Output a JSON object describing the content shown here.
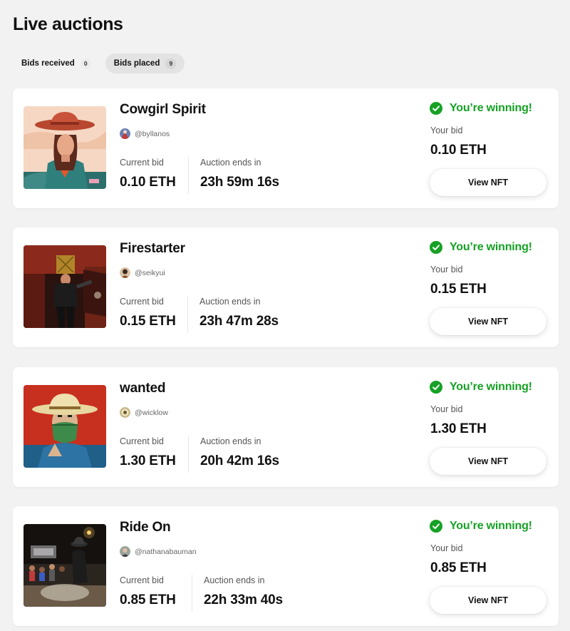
{
  "page_title": "Live auctions",
  "tabs": [
    {
      "label": "Bids received",
      "count": "0",
      "active": false
    },
    {
      "label": "Bids placed",
      "count": "9",
      "active": true
    }
  ],
  "colors": {
    "winning": "#16a125",
    "background": "#f2f2f2",
    "card": "#ffffff"
  },
  "labels": {
    "current_bid": "Current bid",
    "auction_ends": "Auction ends in",
    "winning": "You’re winning!",
    "your_bid": "Your bid",
    "view_button": "View NFT"
  },
  "auctions": [
    {
      "title": "Cowgirl Spirit",
      "creator": "@byllanos",
      "current_bid": "0.10 ETH",
      "ends_in": "23h 59m 16s",
      "your_bid": "0.10 ETH",
      "artwork_icon": "cowgirl-portrait"
    },
    {
      "title": "Firestarter",
      "creator": "@seikyui",
      "current_bid": "0.15 ETH",
      "ends_in": "23h 47m 28s",
      "your_bid": "0.15 ETH",
      "artwork_icon": "red-western-figure"
    },
    {
      "title": "wanted",
      "creator": "@wicklow",
      "current_bid": "1.30 ETH",
      "ends_in": "20h 42m 16s",
      "your_bid": "1.30 ETH",
      "artwork_icon": "masked-cowboy"
    },
    {
      "title": "Ride On",
      "creator": "@nathanabauman",
      "current_bid": "0.85 ETH",
      "ends_in": "22h 33m 40s",
      "your_bid": "0.85 ETH",
      "artwork_icon": "rodeo-photo"
    }
  ]
}
